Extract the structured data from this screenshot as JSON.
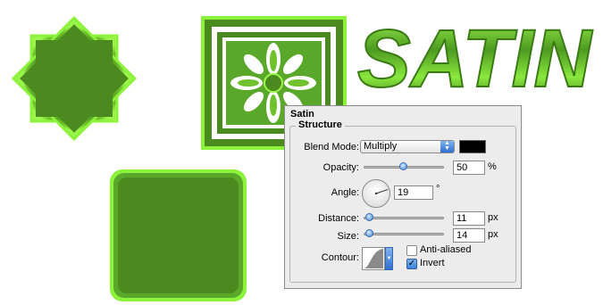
{
  "artwork": {
    "satin_text": "SATIN",
    "colors": {
      "fill": "#4a8a1e",
      "highlight": "#8cf23a",
      "dark": "#2f6412"
    }
  },
  "dialog": {
    "title": "Satin",
    "group_title": "Structure",
    "blend_mode": {
      "label": "Blend Mode:",
      "value": "Multiply",
      "color": "#000000"
    },
    "opacity": {
      "label": "Opacity:",
      "value": "50",
      "unit": "%",
      "slider_fraction": 0.5
    },
    "angle": {
      "label": "Angle:",
      "value": "19",
      "unit": "°",
      "degrees": 19
    },
    "distance": {
      "label": "Distance:",
      "value": "11",
      "unit": "px",
      "slider_fraction": 0.05
    },
    "size": {
      "label": "Size:",
      "value": "14",
      "unit": "px",
      "slider_fraction": 0.05
    },
    "contour": {
      "label": "Contour:",
      "anti_aliased_label": "Anti-aliased",
      "anti_aliased": false,
      "invert_label": "Invert",
      "invert": true
    }
  }
}
